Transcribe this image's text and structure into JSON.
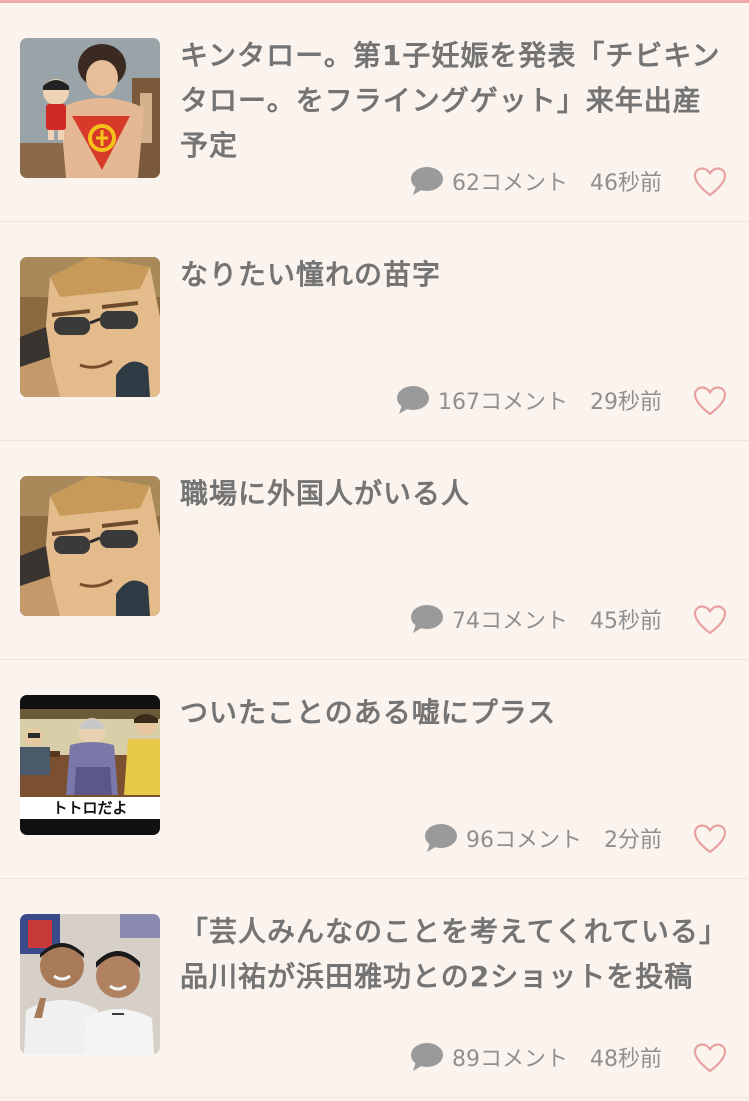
{
  "feed": {
    "items": [
      {
        "title": "キンタロー。第1子妊娠を発表「チビキンタロー。をフライングゲット」来年出産予定",
        "comments": "62コメント",
        "time": "46秒前",
        "thumb_icon": "performer-photo-thumbnail"
      },
      {
        "title": "なりたい憧れの苗字",
        "comments": "167コメント",
        "time": "29秒前",
        "thumb_icon": "anime-sunglasses-man-thumbnail"
      },
      {
        "title": "職場に外国人がいる人",
        "comments": "74コメント",
        "time": "45秒前",
        "thumb_icon": "anime-sunglasses-man-thumbnail"
      },
      {
        "title": "ついたことのある嘘にプラス",
        "comments": "96コメント",
        "time": "2分前",
        "thumb_icon": "anime-scene-thumbnail",
        "thumb_caption": "トトロだよ"
      },
      {
        "title": "「芸人みんなのことを考えてくれている」品川祐が浜田雅功との2ショットを投稿",
        "comments": "89コメント",
        "time": "48秒前",
        "thumb_icon": "two-men-photo-thumbnail"
      }
    ]
  },
  "colors": {
    "background": "#fbf4ee",
    "title": "#747474",
    "meta": "#8f8f8f",
    "heart": "#e8a0a0",
    "top_accent": "#f0a8a8"
  },
  "icons": {
    "comment": "comment-bubble-icon",
    "like": "heart-outline-icon"
  }
}
